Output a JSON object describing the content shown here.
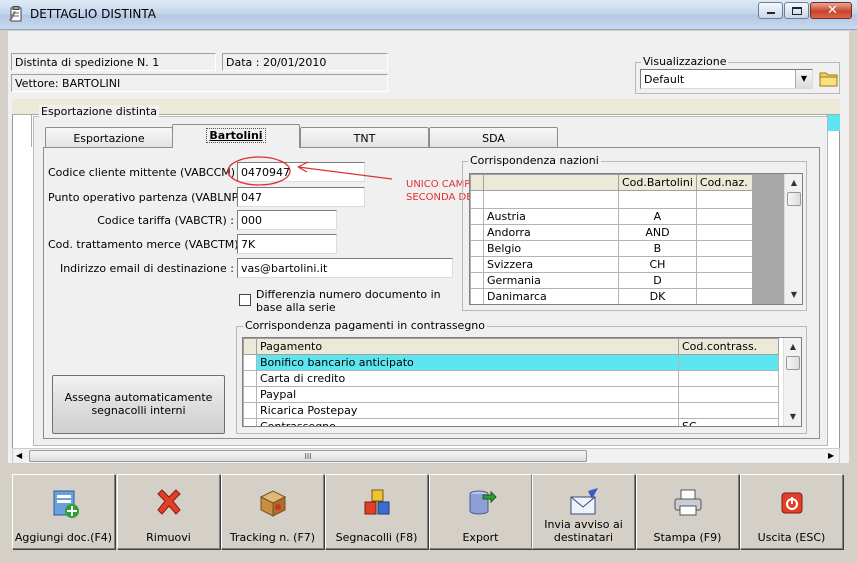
{
  "window": {
    "title": "DETTAGLIO DISTINTA"
  },
  "header": {
    "distinta_label": "Distinta di spedizione N. 1",
    "data_label": "Data : 20/01/2010",
    "vettore_label": "Vettore: BARTOLINI",
    "visualizzazione_label": "Visualizzazione",
    "visualizzazione_value": "Default"
  },
  "export_group": {
    "label": "Esportazione distinta"
  },
  "tabs": [
    {
      "label": "Esportazione"
    },
    {
      "label": "Bartolini"
    },
    {
      "label": "TNT"
    },
    {
      "label": "SDA"
    }
  ],
  "form": {
    "codice_cliente": {
      "label": "Codice cliente mittente (VABCCM) :",
      "value": "0470947"
    },
    "punto_operativo": {
      "label": "Punto operativo partenza (VABLNP) :",
      "value": "047"
    },
    "codice_tariffa": {
      "label": "Codice tariffa (VABCTR) :",
      "value": "000"
    },
    "cod_trattamento": {
      "label": "Cod. trattamento merce (VABCTM) :",
      "value": "7K"
    },
    "email": {
      "label": "Indirizzo email di destinazione :",
      "value": "vas@bartolini.it"
    },
    "differenzia": {
      "label": "Differenzia numero documento in base alla serie"
    }
  },
  "annotation": {
    "text": "UNICO CAMPO CHE VARIA A SECONDA DELL' AZIENDA",
    "color": "#e03030"
  },
  "nazioni": {
    "label": "Corrispondenza nazioni",
    "headers": [
      "",
      "Cod.Bartolini",
      "Cod.naz."
    ],
    "rows": [
      {
        "name": "Austria",
        "code": "A",
        "naz": ""
      },
      {
        "name": "Andorra",
        "code": "AND",
        "naz": ""
      },
      {
        "name": "Belgio",
        "code": "B",
        "naz": ""
      },
      {
        "name": "Svizzera",
        "code": "CH",
        "naz": ""
      },
      {
        "name": "Germania",
        "code": "D",
        "naz": ""
      },
      {
        "name": "Danimarca",
        "code": "DK",
        "naz": ""
      }
    ]
  },
  "pagamenti": {
    "label": "Corrispondenza pagamenti in contrassegno",
    "headers": [
      "Pagamento",
      "Cod.contrass."
    ],
    "selected_color": "#5ee6f0",
    "rows": [
      {
        "name": "Bonifico bancario anticipato",
        "code": ""
      },
      {
        "name": "Carta di credito",
        "code": ""
      },
      {
        "name": "Paypal",
        "code": ""
      },
      {
        "name": "Ricarica Postepay",
        "code": ""
      },
      {
        "name": "Contrassegno",
        "code": "SC"
      }
    ]
  },
  "assegna_button": {
    "label": "Assegna automaticamente segnacolli interni"
  },
  "hscroll": {
    "thumb_glyph": "III"
  },
  "toolbar": [
    {
      "label": "Aggiungi doc.(F4)",
      "icon": "add-document-icon"
    },
    {
      "label": "Rimuovi",
      "icon": "remove-x-icon"
    },
    {
      "label": "Tracking n. (F7)",
      "icon": "package-icon"
    },
    {
      "label": "Segnacolli (F8)",
      "icon": "cubes-icon"
    },
    {
      "label": "Export",
      "icon": "export-database-icon"
    },
    {
      "label": "Invia avviso ai destinatari",
      "icon": "mail-icon"
    },
    {
      "label": "Stampa (F9)",
      "icon": "printer-icon"
    },
    {
      "label": "Uscita (ESC)",
      "icon": "exit-power-icon"
    }
  ]
}
